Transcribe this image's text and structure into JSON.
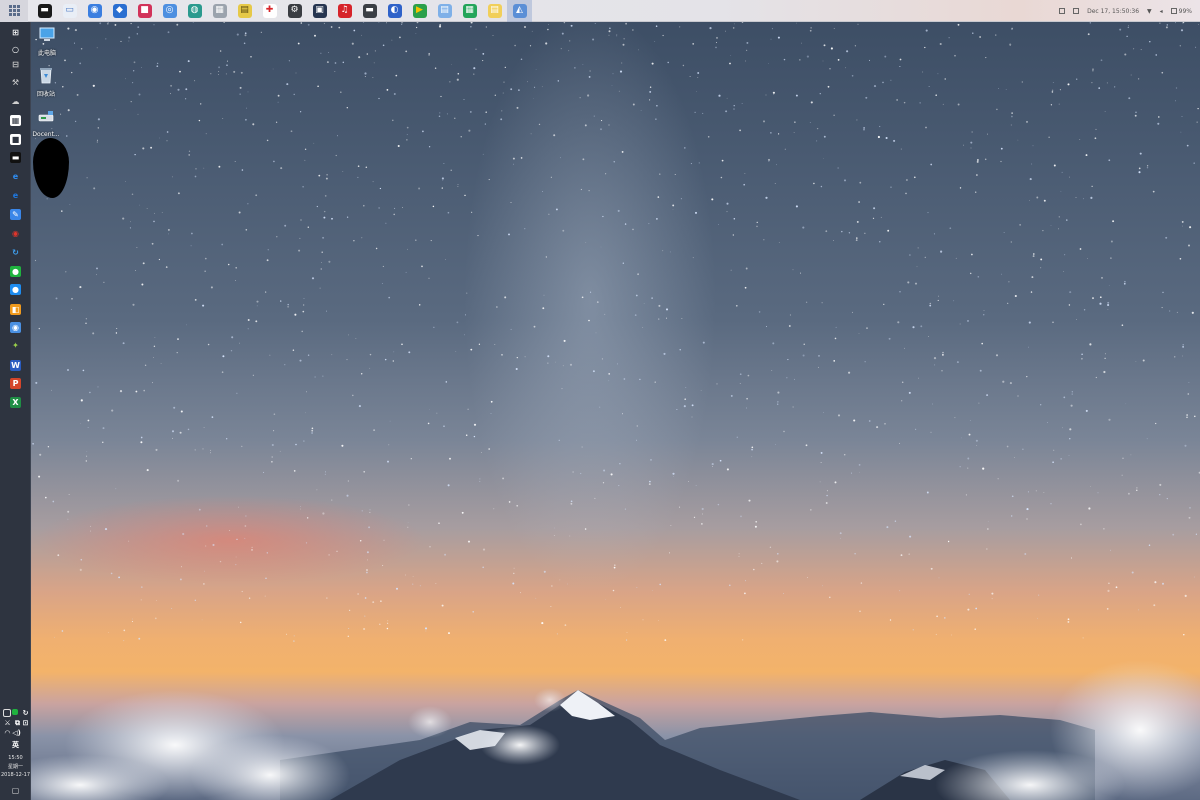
{
  "top_bar": {
    "apps": [
      {
        "name": "terminal-app",
        "glyph": "▬",
        "color": "#1a1a1a",
        "fg": "#ffffff"
      },
      {
        "name": "file-manager-app",
        "glyph": "▭",
        "color": "#e9eef6",
        "fg": "#4a78c2"
      },
      {
        "name": "browser-app",
        "glyph": "◉",
        "color": "#3b7ee0",
        "fg": "#ffffff"
      },
      {
        "name": "code-editor-app",
        "glyph": "◆",
        "color": "#2a6fd1",
        "fg": "#ffffff"
      },
      {
        "name": "red-app",
        "glyph": "■",
        "color": "#d2335a",
        "fg": "#ffffff"
      },
      {
        "name": "web-app",
        "glyph": "◎",
        "color": "#4d8fe0",
        "fg": "#ffffff"
      },
      {
        "name": "teal-app",
        "glyph": "◍",
        "color": "#2b9a8e",
        "fg": "#ffffff"
      },
      {
        "name": "system-monitor-app",
        "glyph": "▦",
        "color": "#9ba3ad",
        "fg": "#ffffff"
      },
      {
        "name": "notes-app",
        "glyph": "▤",
        "color": "#e6c948",
        "fg": "#5a4a10"
      },
      {
        "name": "red-cross-app",
        "glyph": "✚",
        "color": "#ffffff",
        "fg": "#d8262b"
      },
      {
        "name": "settings-app",
        "glyph": "⚙",
        "color": "#3a3d42",
        "fg": "#ffffff"
      },
      {
        "name": "dark-app",
        "glyph": "▣",
        "color": "#263550",
        "fg": "#ffffff"
      },
      {
        "name": "music-app",
        "glyph": "♫",
        "color": "#d6232a",
        "fg": "#ffffff"
      },
      {
        "name": "screen-app",
        "glyph": "▬",
        "color": "#3b3f45",
        "fg": "#ffffff"
      },
      {
        "name": "blue-swirl-app",
        "glyph": "◐",
        "color": "#2f62c9",
        "fg": "#ffffff"
      },
      {
        "name": "play-store-app",
        "glyph": "▶",
        "color": "#2ba04a",
        "fg": "#f5c400"
      },
      {
        "name": "document-app",
        "glyph": "▤",
        "color": "#7fb0e8",
        "fg": "#ffffff"
      },
      {
        "name": "spreadsheet-app",
        "glyph": "▦",
        "color": "#24a55a",
        "fg": "#ffffff"
      },
      {
        "name": "text-app",
        "glyph": "▤",
        "color": "#f1cf5a",
        "fg": "#ffffff"
      },
      {
        "name": "image-viewer-app",
        "glyph": "◭",
        "color": "#5b8fd6",
        "fg": "#ffffff"
      }
    ],
    "active_index": 19,
    "tray": {
      "datetime": "Dec 17, 15:50:36",
      "battery": "99%"
    }
  },
  "sidebar": {
    "icons": [
      {
        "name": "windows-start-icon",
        "glyph": "⊞",
        "color": "#2e3440",
        "fg": "#ffffff"
      },
      {
        "name": "search-circle-icon",
        "glyph": "○",
        "color": "#2e3440",
        "fg": "#ffffff"
      },
      {
        "name": "task-view-icon",
        "glyph": "⊟",
        "color": "#2e3440",
        "fg": "#d0d0d0"
      },
      {
        "name": "tools-icon",
        "glyph": "⚒",
        "color": "#2e3440",
        "fg": "#d0d0d0"
      },
      {
        "name": "cloud-icon",
        "glyph": "☁",
        "color": "#2e3440",
        "fg": "#d0d0d0"
      },
      {
        "name": "calculator-icon",
        "glyph": "▦",
        "color": "#ffffff",
        "fg": "#2e3440"
      },
      {
        "name": "store-icon",
        "glyph": "■",
        "color": "#ffffff",
        "fg": "#2e3440"
      },
      {
        "name": "terminal-icon",
        "glyph": "▬",
        "color": "#111111",
        "fg": "#ffffff"
      },
      {
        "name": "edge-icon",
        "glyph": "e",
        "color": "#2e3440",
        "fg": "#2e8cf0"
      },
      {
        "name": "ie-icon",
        "glyph": "e",
        "color": "#2e3440",
        "fg": "#1e78e0"
      },
      {
        "name": "pen-icon",
        "glyph": "✎",
        "color": "#3a86e8",
        "fg": "#ffffff"
      },
      {
        "name": "weibo-icon",
        "glyph": "◉",
        "color": "#2e3440",
        "fg": "#e0352b"
      },
      {
        "name": "refresh-icon",
        "glyph": "↻",
        "color": "#2e3440",
        "fg": "#3fa0f0"
      },
      {
        "name": "wechat-icon",
        "glyph": "●",
        "color": "#1fb33f",
        "fg": "#ffffff"
      },
      {
        "name": "chat-bubble-icon",
        "glyph": "●",
        "color": "#1e8cf0",
        "fg": "#ffffff"
      },
      {
        "name": "orange-box-icon",
        "glyph": "◧",
        "color": "#f09a1e",
        "fg": "#ffffff"
      },
      {
        "name": "camera-icon",
        "glyph": "◉",
        "color": "#4a90e2",
        "fg": "#ffffff"
      },
      {
        "name": "bird-icon",
        "glyph": "✦",
        "color": "#2e3440",
        "fg": "#9ad04a"
      },
      {
        "name": "word-icon",
        "glyph": "W",
        "color": "#2a5cc0",
        "fg": "#ffffff"
      },
      {
        "name": "powerpoint-icon",
        "glyph": "P",
        "color": "#d4452a",
        "fg": "#ffffff"
      },
      {
        "name": "excel-icon",
        "glyph": "X",
        "color": "#1f8e45",
        "fg": "#ffffff"
      }
    ],
    "clock_time": "15:50",
    "clock_weekday": "星期一",
    "clock_date": "2018-12-17"
  },
  "desktop": {
    "icons": [
      {
        "label": "此电脑"
      },
      {
        "label": "回收站"
      },
      {
        "label": "Docent..."
      }
    ]
  }
}
